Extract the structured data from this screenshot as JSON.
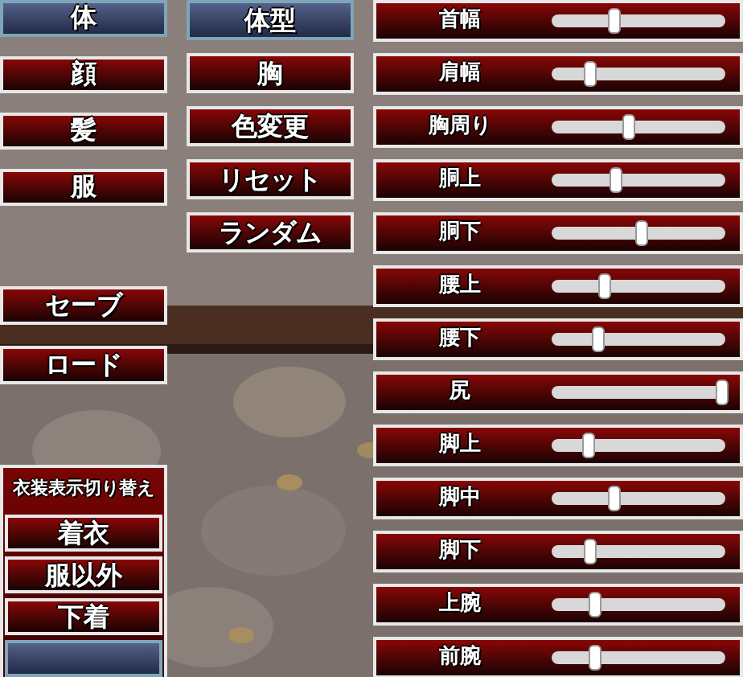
{
  "category_tabs": [
    {
      "label": "体",
      "selected": true
    },
    {
      "label": "顔",
      "selected": false
    },
    {
      "label": "髪",
      "selected": false
    },
    {
      "label": "服",
      "selected": false
    }
  ],
  "sub_tabs": [
    {
      "label": "体型",
      "selected": true
    },
    {
      "label": "胸",
      "selected": false
    },
    {
      "label": "色変更",
      "selected": false
    },
    {
      "label": "リセット",
      "selected": false
    },
    {
      "label": "ランダム",
      "selected": false
    }
  ],
  "save_button": "セーブ",
  "load_button": "ロード",
  "outfit_panel": {
    "title": "衣装表示切り替え",
    "options": [
      {
        "label": "着衣",
        "selected": false
      },
      {
        "label": "服以外",
        "selected": false
      },
      {
        "label": "下着",
        "selected": false
      },
      {
        "selected": true
      }
    ]
  },
  "sliders": [
    {
      "label": "首幅",
      "level": 0.36
    },
    {
      "label": "肩幅",
      "level": 0.22
    },
    {
      "label": "胸周り",
      "level": 0.44
    },
    {
      "label": "胴上",
      "level": 0.37
    },
    {
      "label": "胴下",
      "level": 0.52
    },
    {
      "label": "腰上",
      "level": 0.31
    },
    {
      "label": "腰下",
      "level": 0.27
    },
    {
      "label": "尻",
      "level": 0.98
    },
    {
      "label": "脚上",
      "level": 0.21
    },
    {
      "label": "脚中",
      "level": 0.36
    },
    {
      "label": "脚下",
      "level": 0.22
    },
    {
      "label": "上腕",
      "level": 0.25
    },
    {
      "label": "前腕",
      "level": 0.25
    }
  ]
}
